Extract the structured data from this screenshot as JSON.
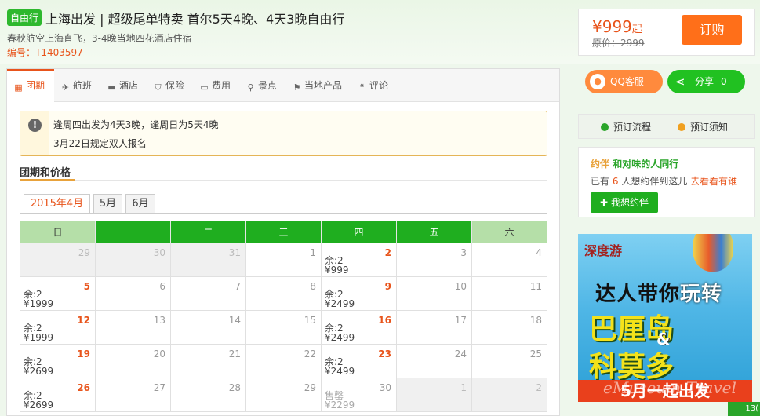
{
  "header": {
    "tag": "自由行",
    "title": "上海出发 | 超级尾单特卖 首尔5天4晚、4天3晚自由行",
    "subtitle": "春秋航空上海直飞，3-4晚当地四花酒店住宿",
    "code": "编号：T1403597"
  },
  "price_box": {
    "price": "¥999",
    "price_suffix": "起",
    "original": "原价：2999",
    "buy_label": "订购"
  },
  "tabs": [
    {
      "label": "团期",
      "icon": "calendar-icon"
    },
    {
      "label": "航班",
      "icon": "plane-icon"
    },
    {
      "label": "酒店",
      "icon": "bed-icon"
    },
    {
      "label": "保险",
      "icon": "shield-icon"
    },
    {
      "label": "费用",
      "icon": "wallet-icon"
    },
    {
      "label": "景点",
      "icon": "location-pin-icon"
    },
    {
      "label": "当地产品",
      "icon": "tag-pin-icon"
    },
    {
      "label": "评论",
      "icon": "comment-icon"
    }
  ],
  "notice": {
    "line1": "逢周四出发为4天3晚，逢周日为5天4晚",
    "line2": "3月22日规定双人报名"
  },
  "section_title": "团期和价格",
  "month_tabs": [
    "2015年4月",
    "5月",
    "6月"
  ],
  "calendar": {
    "weekdays": [
      "日",
      "一",
      "二",
      "三",
      "四",
      "五",
      "六"
    ],
    "rows": [
      [
        {
          "d": "29",
          "dis": true
        },
        {
          "d": "30",
          "dis": true
        },
        {
          "d": "31",
          "dis": true
        },
        {
          "d": "1"
        },
        {
          "d": "2",
          "hot": true,
          "s": "余:2",
          "p": "¥999"
        },
        {
          "d": "3"
        },
        {
          "d": "4"
        }
      ],
      [
        {
          "d": "5",
          "hot": true,
          "s": "余:2",
          "p": "¥1999"
        },
        {
          "d": "6"
        },
        {
          "d": "7"
        },
        {
          "d": "8"
        },
        {
          "d": "9",
          "hot": true,
          "s": "余:2",
          "p": "¥2499"
        },
        {
          "d": "10"
        },
        {
          "d": "11"
        }
      ],
      [
        {
          "d": "12",
          "hot": true,
          "s": "余:2",
          "p": "¥1999"
        },
        {
          "d": "13"
        },
        {
          "d": "14"
        },
        {
          "d": "15"
        },
        {
          "d": "16",
          "hot": true,
          "s": "余:2",
          "p": "¥2499"
        },
        {
          "d": "17"
        },
        {
          "d": "18"
        }
      ],
      [
        {
          "d": "19",
          "hot": true,
          "s": "余:2",
          "p": "¥2699"
        },
        {
          "d": "20"
        },
        {
          "d": "21"
        },
        {
          "d": "22"
        },
        {
          "d": "23",
          "hot": true,
          "s": "余:2",
          "p": "¥2499"
        },
        {
          "d": "24"
        },
        {
          "d": "25"
        }
      ],
      [
        {
          "d": "26",
          "hot": true,
          "s": "余:2",
          "p": "¥2699"
        },
        {
          "d": "27"
        },
        {
          "d": "28"
        },
        {
          "d": "29"
        },
        {
          "d": "30",
          "sold": true,
          "s": "售罄",
          "p": "¥2299"
        },
        {
          "d": "1",
          "dis": true
        },
        {
          "d": "2",
          "dis": true
        }
      ]
    ]
  },
  "contact": {
    "qq_label": "QQ客服",
    "share_label": "分享",
    "share_count": "0"
  },
  "process": {
    "flow": "预订流程",
    "notes": "预订须知"
  },
  "yueban": {
    "brand": "约伴",
    "slogan": "和对味的人同行",
    "text_prefix": "已有",
    "count": "6",
    "text_suffix": "人想约伴到这儿",
    "link": "去看看有谁",
    "button": "我想约伴"
  },
  "ad": {
    "logo": "深度游",
    "line1a": "达人带你",
    "line1b": "玩转",
    "line2": "巴厘岛",
    "amp": "&",
    "line3": "科莫多",
    "line4": "5月一起出发",
    "watermark": "eMuseum Travel"
  },
  "corner_badge": "13("
}
